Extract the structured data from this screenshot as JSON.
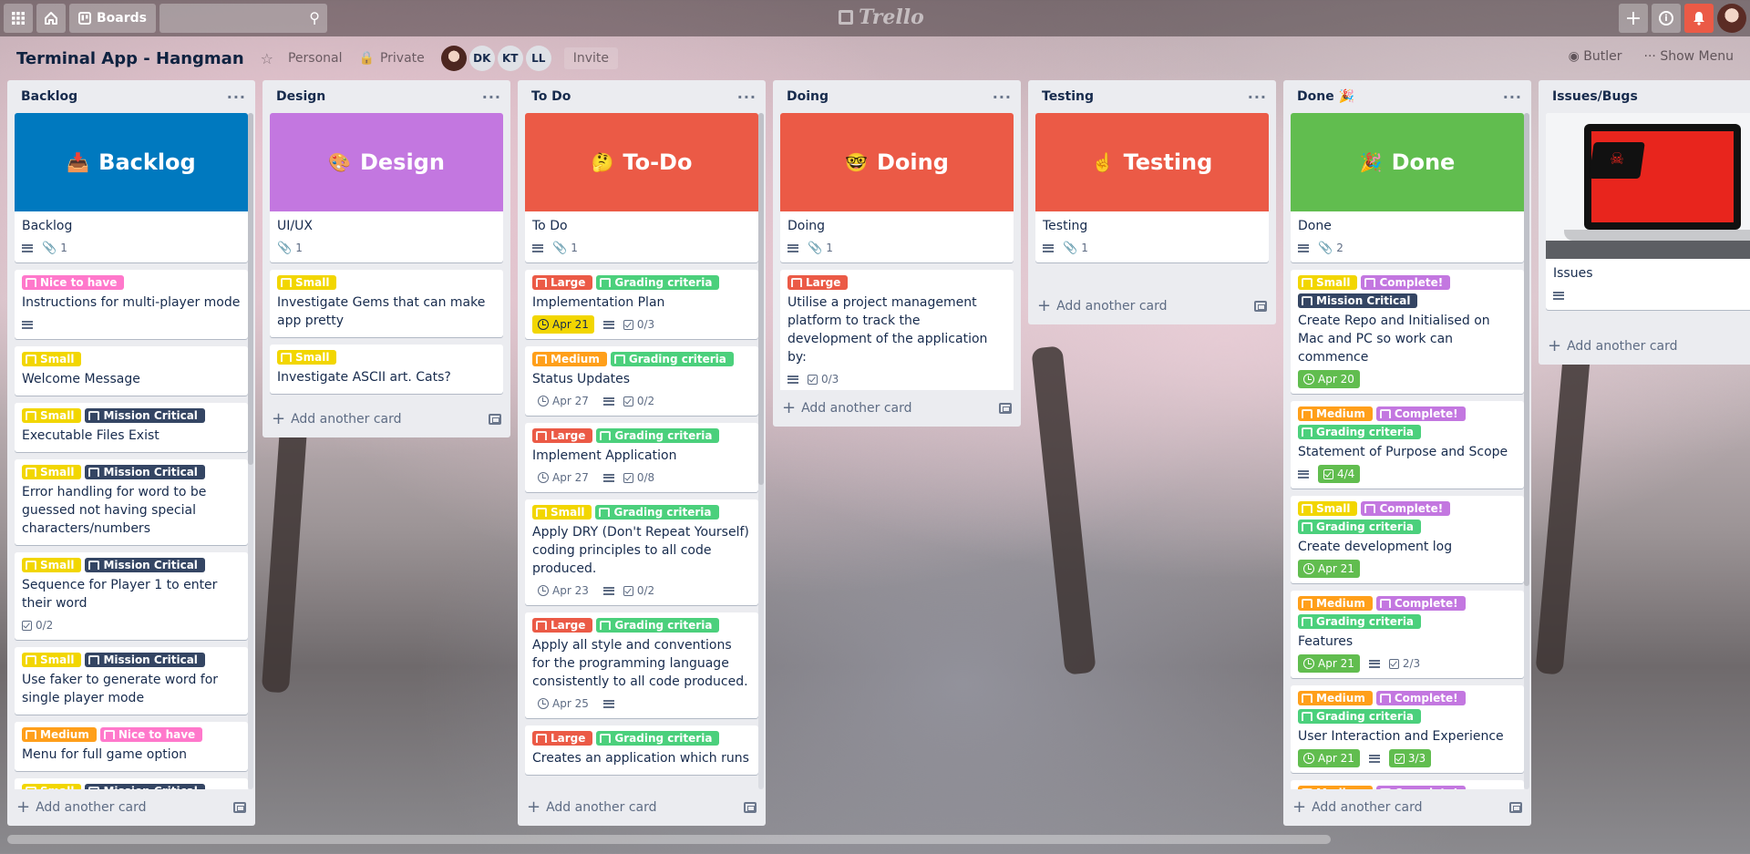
{
  "topbar": {
    "boards_label": "Boards",
    "logo": "Trello"
  },
  "board": {
    "title": "Terminal App - Hangman",
    "visibility_team": "Personal",
    "visibility": "Private",
    "members": [
      "DK",
      "KT",
      "LL"
    ],
    "invite_label": "Invite",
    "butler_label": "Butler",
    "show_menu_label": "Show Menu"
  },
  "add_card_label": "Add another card",
  "colors": {
    "cover_blue": "#0079bf",
    "cover_purple": "#c377e0",
    "cover_red": "#eb5a46",
    "cover_green": "#61bd4f",
    "label_small": "#f2d600",
    "label_medium": "#ff9f1a",
    "label_large": "#eb5a46",
    "label_nice": "#ff78cb",
    "label_mission": "#344563",
    "label_grading": "#4bd07c",
    "label_complete": "#c377e0"
  },
  "labels": {
    "small": "Small",
    "medium": "Medium",
    "large": "Large",
    "nice": "Nice to have",
    "mission": "Mission Critical",
    "grading": "Grading criteria",
    "complete": "Complete!"
  },
  "lists": [
    {
      "title": "Backlog",
      "cover": {
        "emoji": "📥",
        "text": "Backlog"
      },
      "cards": [
        {
          "title": "Backlog",
          "desc": true,
          "attach": "1"
        },
        {
          "labels": [
            "nice"
          ],
          "title": "Instructions for multi-player mode",
          "desc": true
        },
        {
          "labels": [
            "small"
          ],
          "title": "Welcome Message"
        },
        {
          "labels": [
            "small",
            "mission"
          ],
          "title": "Executable Files Exist"
        },
        {
          "labels": [
            "small",
            "mission"
          ],
          "title": "Error handling for word to be guessed not having special characters/numbers"
        },
        {
          "labels": [
            "small",
            "mission"
          ],
          "title": "Sequence for Player 1 to enter their word",
          "check": "0/2"
        },
        {
          "labels": [
            "small",
            "mission"
          ],
          "title": "Use faker to generate word for single player mode"
        },
        {
          "labels": [
            "medium",
            "nice"
          ],
          "title": "Menu for full game option"
        },
        {
          "labels": [
            "small",
            "mission"
          ],
          "title": ""
        }
      ]
    },
    {
      "title": "Design",
      "cover": {
        "emoji": "🎨",
        "text": "Design"
      },
      "cards": [
        {
          "title": "UI/UX",
          "attach": "1"
        },
        {
          "labels": [
            "small"
          ],
          "title": "Investigate Gems that can make app pretty"
        },
        {
          "labels": [
            "small"
          ],
          "title": "Investigate ASCII art. Cats?"
        }
      ]
    },
    {
      "title": "To Do",
      "cover": {
        "emoji": "🤔",
        "text": "To-Do"
      },
      "cards": [
        {
          "title": "To Do",
          "desc": true,
          "attach": "1"
        },
        {
          "labels": [
            "large",
            "grading"
          ],
          "title": "Implementation Plan",
          "due": "Apr 21",
          "due_state": "soon",
          "desc": true,
          "check": "0/3"
        },
        {
          "labels": [
            "medium",
            "grading"
          ],
          "title": "Status Updates",
          "due": "Apr 27",
          "desc": true,
          "check": "0/2"
        },
        {
          "labels": [
            "large",
            "grading"
          ],
          "title": "Implement Application",
          "due": "Apr 27",
          "desc": true,
          "check": "0/8"
        },
        {
          "labels": [
            "small",
            "grading"
          ],
          "title": "Apply DRY (Don't Repeat Yourself) coding principles to all code produced.",
          "due": "Apr 23",
          "desc": true,
          "check": "0/2"
        },
        {
          "labels": [
            "large",
            "grading"
          ],
          "title": "Apply all style and conventions for the programming language consistently to all code produced.",
          "due": "Apr 25",
          "desc": true
        },
        {
          "labels": [
            "large",
            "grading"
          ],
          "title": "Creates an application which runs"
        }
      ]
    },
    {
      "title": "Doing",
      "cover": {
        "emoji": "🤓",
        "text": "Doing"
      },
      "cards": [
        {
          "title": "Doing",
          "desc": true,
          "attach": "1"
        },
        {
          "labels": [
            "large"
          ],
          "title": "Utilise a project management platform to track the development of the application by:",
          "desc": true,
          "check": "0/3"
        }
      ]
    },
    {
      "title": "Testing",
      "cover": {
        "emoji": "☝️",
        "text": "Testing"
      },
      "cards": [
        {
          "title": "Testing",
          "desc": true,
          "attach": "1"
        }
      ]
    },
    {
      "title": "Done 🎉",
      "cover": {
        "emoji": "🎉",
        "text": "Done"
      },
      "cards": [
        {
          "title": "Done",
          "desc": true,
          "attach": "2"
        },
        {
          "labels": [
            "small",
            "complete",
            "mission"
          ],
          "title": "Create Repo and Initialised on Mac and PC so work can commence",
          "due": "Apr 20",
          "due_state": "done"
        },
        {
          "labels": [
            "medium",
            "complete",
            "grading"
          ],
          "title": "Statement of Purpose and Scope",
          "desc": true,
          "check": "4/4",
          "check_state": "done"
        },
        {
          "labels": [
            "small",
            "complete",
            "grading"
          ],
          "title": "Create development log",
          "due": "Apr 21",
          "due_state": "done"
        },
        {
          "labels": [
            "medium",
            "complete",
            "grading"
          ],
          "title": "Features",
          "due": "Apr 21",
          "due_state": "done",
          "desc": true,
          "check": "2/3"
        },
        {
          "labels": [
            "medium",
            "complete",
            "grading"
          ],
          "title": "User Interaction and Experience",
          "due": "Apr 21",
          "due_state": "done",
          "desc": true,
          "check": "3/3",
          "check_state": "done"
        },
        {
          "labels": [
            "medium",
            "complete"
          ],
          "title": ""
        }
      ]
    },
    {
      "title": "Issues/Bugs",
      "image_cover": true,
      "cards": [
        {
          "title": "Issues",
          "desc": true
        }
      ]
    }
  ]
}
